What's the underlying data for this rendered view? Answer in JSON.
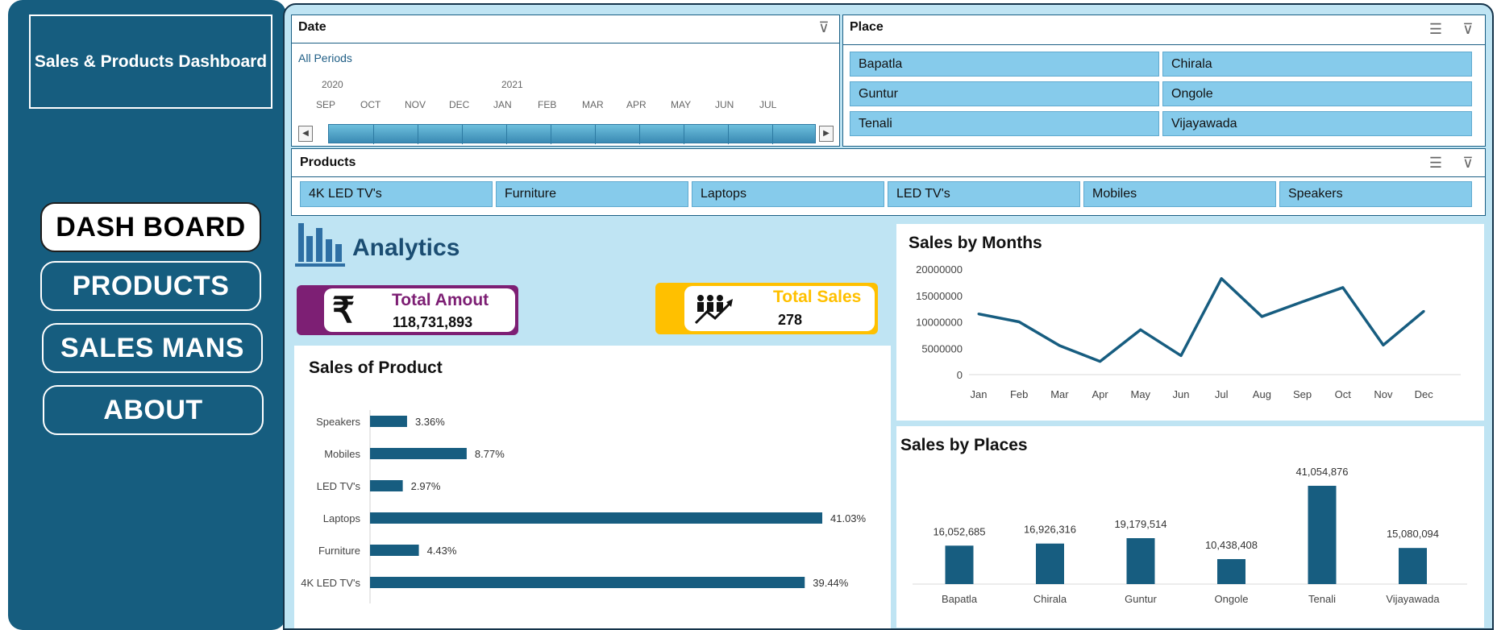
{
  "sidebar": {
    "title": "Sales & Products Dashboard",
    "nav": [
      "DASH BOARD",
      "PRODUCTS",
      "SALES MANS",
      "ABOUT"
    ]
  },
  "date_slicer": {
    "header": "Date",
    "period_label": "All Periods",
    "years": [
      "2020",
      "2021"
    ],
    "months": [
      "SEP",
      "OCT",
      "NOV",
      "DEC",
      "JAN",
      "FEB",
      "MAR",
      "APR",
      "MAY",
      "JUN",
      "JUL"
    ]
  },
  "place_slicer": {
    "header": "Place",
    "items": [
      "Bapatla",
      "Chirala",
      "Guntur",
      "Ongole",
      "Tenali",
      "Vijayawada"
    ]
  },
  "products_slicer": {
    "header": "Products",
    "items": [
      "4K LED TV's",
      "Furniture",
      "Laptops",
      "LED TV's",
      "Mobiles",
      "Speakers"
    ]
  },
  "analytics": {
    "title": "Analytics"
  },
  "kpis": {
    "amount": {
      "label": "Total Amout",
      "value": "118,731,893",
      "symbol": "₹",
      "color": "#7d1f74"
    },
    "sales": {
      "label": "Total Sales",
      "value": "278",
      "color": "#ffc000"
    }
  },
  "colors": {
    "accent": "#165d7f",
    "slicer_item": "#86cbeb",
    "background": "#bfe4f3",
    "series": "#175d80"
  },
  "chart_data": [
    {
      "type": "bar",
      "orientation": "horizontal",
      "title": "Sales of Product",
      "categories": [
        "Speakers",
        "Mobiles",
        "LED TV's",
        "Laptops",
        "Furniture",
        "4K LED TV's"
      ],
      "values": [
        3.36,
        8.77,
        2.97,
        41.03,
        4.43,
        39.44
      ],
      "labels": [
        "3.36%",
        "8.77%",
        "2.97%",
        "41.03%",
        "4.43%",
        "39.44%"
      ]
    },
    {
      "type": "line",
      "title": "Sales by Months",
      "categories": [
        "Jan",
        "Feb",
        "Mar",
        "Apr",
        "May",
        "Jun",
        "Jul",
        "Aug",
        "Sep",
        "Oct",
        "Nov",
        "Dec"
      ],
      "values": [
        11500000,
        10000000,
        5500000,
        2500000,
        8500000,
        3600000,
        18200000,
        11000000,
        13800000,
        16500000,
        5600000,
        12000000
      ],
      "yticks": [
        "20000000",
        "15000000",
        "10000000",
        "5000000",
        "0"
      ],
      "ylim": [
        0,
        20000000
      ]
    },
    {
      "type": "bar",
      "title": "Sales by Places",
      "categories": [
        "Bapatla",
        "Chirala",
        "Guntur",
        "Ongole",
        "Tenali",
        "Vijayawada"
      ],
      "values": [
        16052685,
        16926316,
        19179514,
        10438408,
        41054876,
        15080094
      ],
      "labels": [
        "16,052,685",
        "16,926,316",
        "19,179,514",
        "10,438,408",
        "41,054,876",
        "15,080,094"
      ]
    }
  ]
}
